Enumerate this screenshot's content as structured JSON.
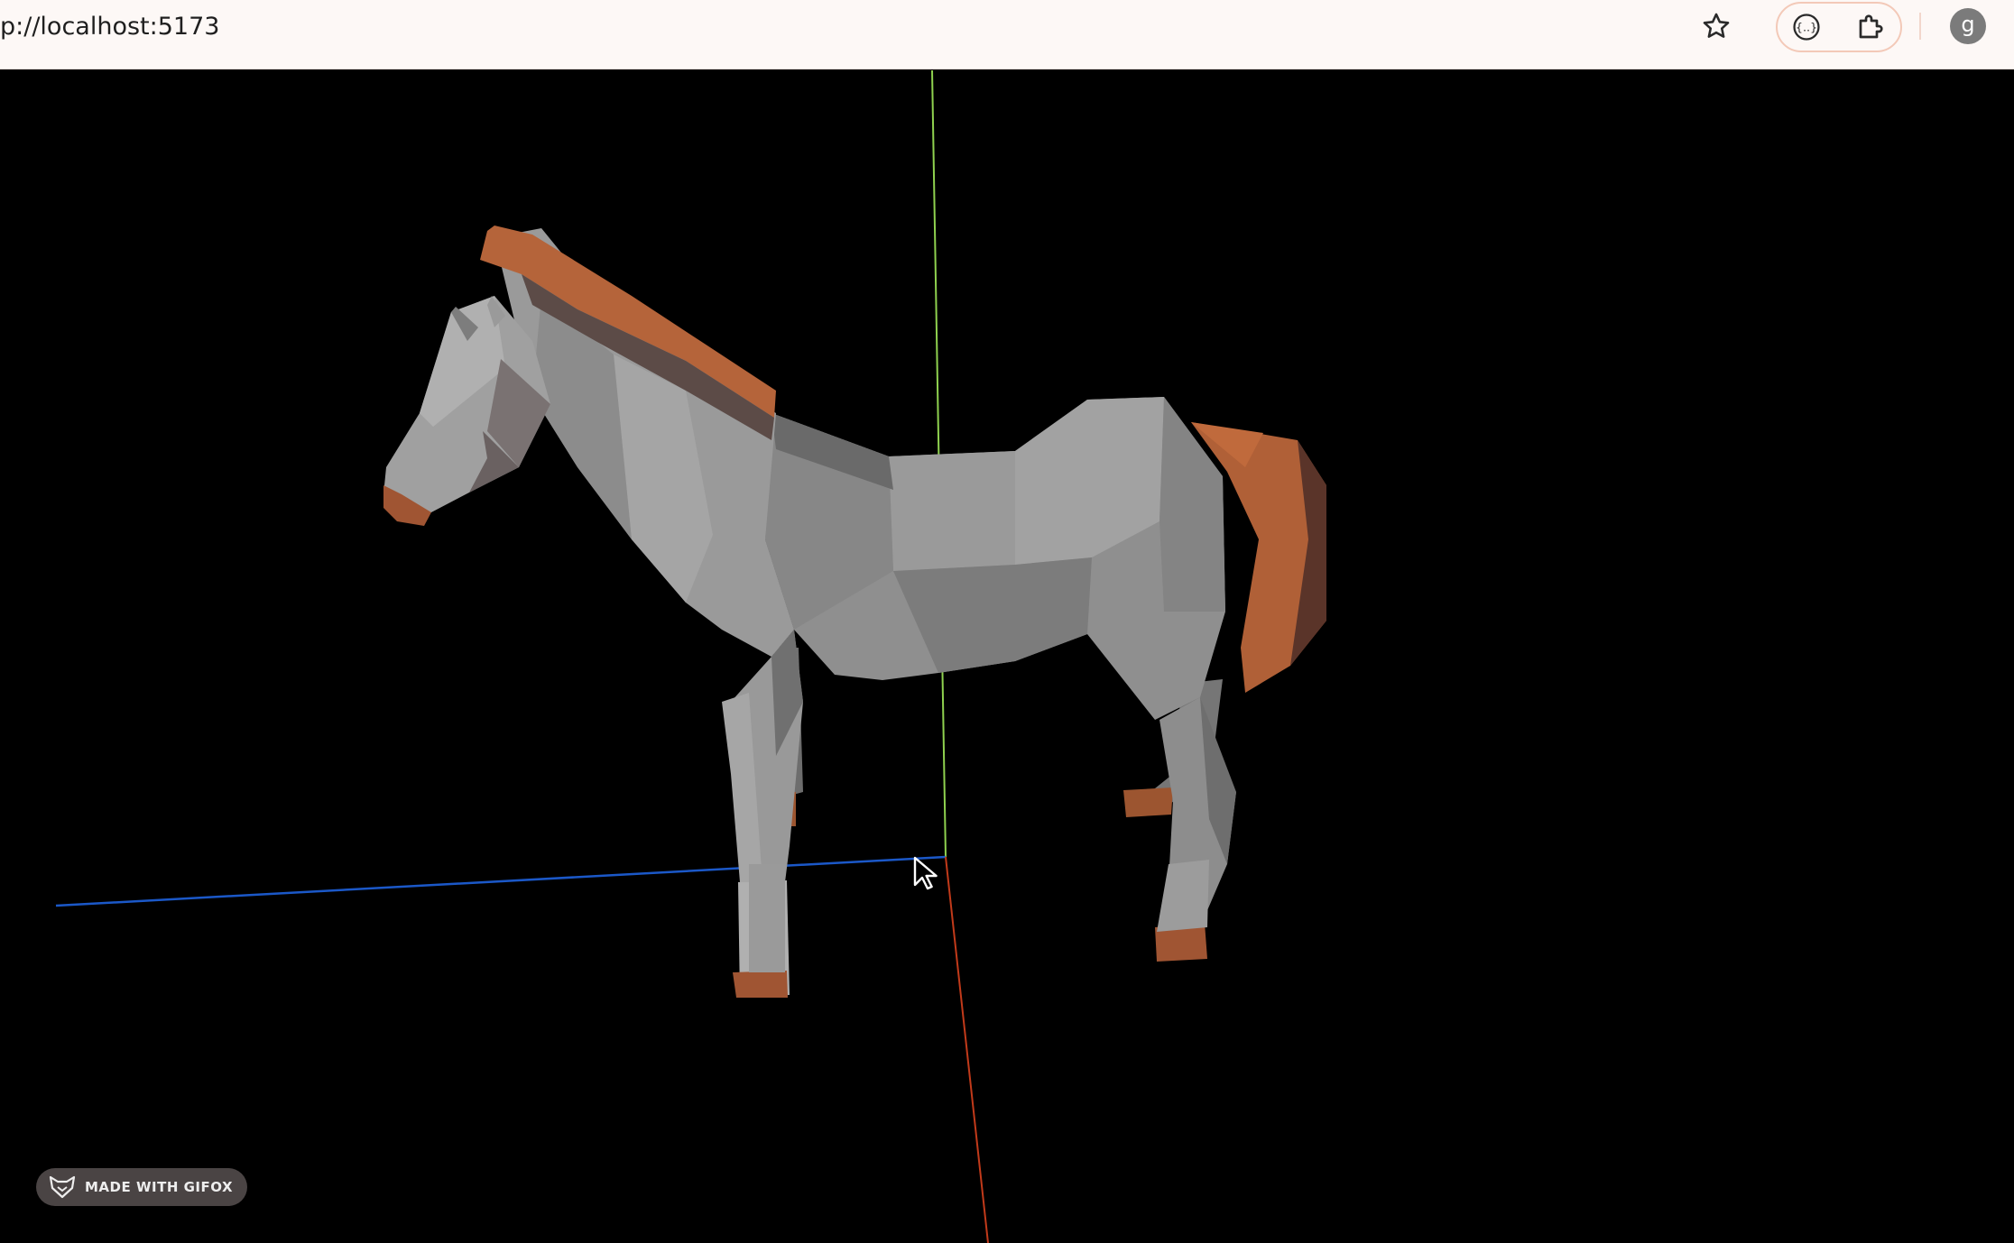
{
  "browser": {
    "url": "p://localhost:5173",
    "profile_initial": "g",
    "icons": {
      "bookmark": "star-icon",
      "devtools": "braces-icon",
      "extensions": "puzzle-icon"
    }
  },
  "scene": {
    "background": "#000000",
    "model": "low-poly-horse",
    "colors": {
      "body": "#8f8f8f",
      "mane_tail_hooves": "#b5643a",
      "axis_x": "#c23a1a",
      "axis_y": "#8fd14f",
      "axis_z": "#1b58c8"
    }
  },
  "watermark": {
    "label": "MADE WITH GIFOX"
  }
}
